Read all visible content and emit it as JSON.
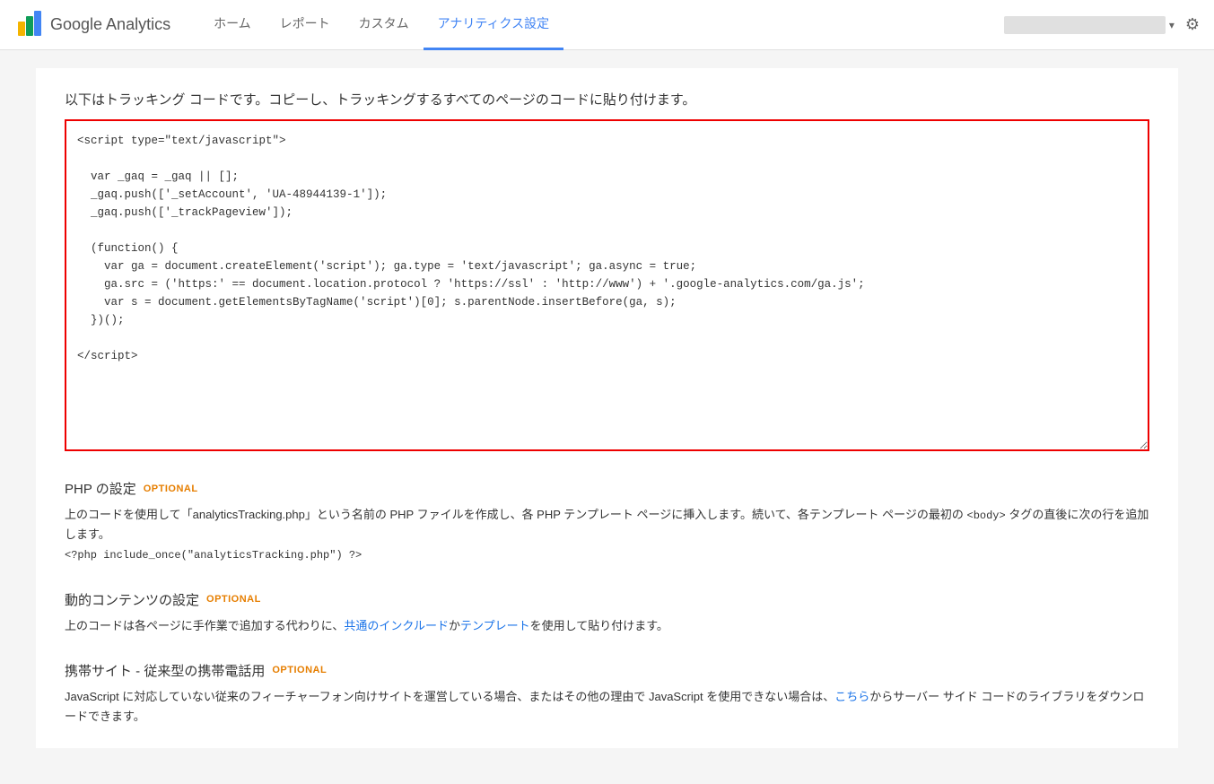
{
  "header": {
    "logo_text": "Google Analytics",
    "nav": [
      {
        "label": "ホーム",
        "active": false
      },
      {
        "label": "レポート",
        "active": false
      },
      {
        "label": "カスタム",
        "active": false
      },
      {
        "label": "アナリティクス設定",
        "active": true
      }
    ],
    "gear_icon": "⚙"
  },
  "main": {
    "instruction_text": "以下はトラッキング コードです。コピーし、トラッキングするすべてのページのコードに貼り付けます。",
    "tracking_code": "<script type=\"text/javascript\">\n\n  var _gaq = _gaq || [];\n  _gaq.push(['_setAccount', 'UA-48944139-1']);\n  _gaq.push(['_trackPageview']);\n\n  (function() {\n    var ga = document.createElement('script'); ga.type = 'text/javascript'; ga.async = true;\n    ga.src = ('https:' == document.location.protocol ? 'https://ssl' : 'http://www') + '.google-analytics.com/ga.js';\n    var s = document.getElementsByTagName('script')[0]; s.parentNode.insertBefore(ga, s);\n  })();\n\n</script>",
    "sections": [
      {
        "id": "php",
        "title": "PHP の設定",
        "optional_label": "OPTIONAL",
        "body_parts": [
          {
            "type": "text",
            "content": "上のコードを使用して「analyticsTracking.php」という名前の PHP ファイルを作成し、各 PHP テンプレート ページに挿入します。続いて、各テンプレート ページの最初の "
          },
          {
            "type": "code",
            "content": "<body>"
          },
          {
            "type": "text",
            "content": " タグの直後に次の行を追加します。"
          }
        ],
        "code_line": "<?php include_once(\"analyticsTracking.php\") ?>"
      },
      {
        "id": "dynamic",
        "title": "動的コンテンツの設定",
        "optional_label": "OPTIONAL",
        "body": "上のコードは各ページに手作業で追加する代わりに、共通のインクルードかテンプレートを使用して貼り付けます。"
      },
      {
        "id": "mobile",
        "title": "携帯サイト - 従来型の携帯電話用",
        "optional_label": "OPTIONAL",
        "body_parts": [
          {
            "type": "text",
            "content": "JavaScript に対応していない従来のフィーチャーフォン向けサイトを運営している場合、またはその他の理由で JavaScript を使用できない場合は、"
          },
          {
            "type": "link",
            "content": "こちら"
          },
          {
            "type": "text",
            "content": "からサーバー サイド コードのライブラリをダウンロードできます。"
          }
        ]
      }
    ]
  }
}
